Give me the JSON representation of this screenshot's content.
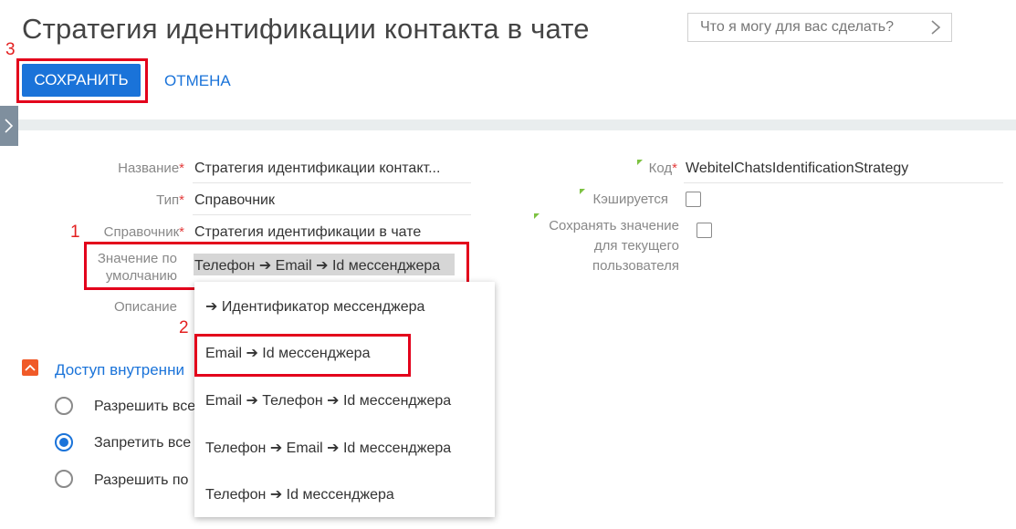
{
  "header": {
    "title": "Стратегия идентификации контакта в чате",
    "helper_placeholder": "Что я могу для вас сделать?",
    "helper_icon": "chevron-right-icon"
  },
  "toolbar": {
    "save_label": "СОХРАНИТЬ",
    "cancel_label": "ОТМЕНА"
  },
  "annotations": {
    "step1": "1",
    "step2": "2",
    "step3": "3"
  },
  "form": {
    "name_label": "Название",
    "name_value": "Стратегия идентификации контакт...",
    "type_label": "Тип",
    "type_value": "Справочник",
    "lookup_label": "Справочник",
    "lookup_value": "Стратегия идентификации в чате",
    "default_label_line1": "Значение по",
    "default_label_line2": "умолчанию",
    "default_value": "Телефон ➔ Email ➔ Id мессенджера",
    "description_label": "Описание",
    "code_label": "Код",
    "code_value": "WebitelChatsIdentificationStrategy",
    "cached_label": "Кэшируется",
    "cached_checked": false,
    "save_user_label_line1": "Сохранять значение",
    "save_user_label_line2": "для текущего",
    "save_user_label_line3": "пользователя",
    "save_user_checked": false
  },
  "dropdown": {
    "options": [
      "➔ Идентификатор мессенджера",
      "Email ➔ Id мессенджера",
      "Email ➔ Телефон ➔ Id мессенджера",
      "Телефон ➔ Email ➔ Id мессенджера",
      "Телефон ➔ Id мессенджера"
    ]
  },
  "access": {
    "title": "Доступ внутренни",
    "options": [
      {
        "label": "Разрешить все",
        "checked": false
      },
      {
        "label": "Запретить все",
        "checked": true
      },
      {
        "label": "Разрешить по",
        "checked": false
      }
    ]
  },
  "colors": {
    "accent": "#1a73d9",
    "annotation_red": "#e3001b",
    "required_star": "#e43b3b",
    "section_toggle": "#f05a28"
  }
}
